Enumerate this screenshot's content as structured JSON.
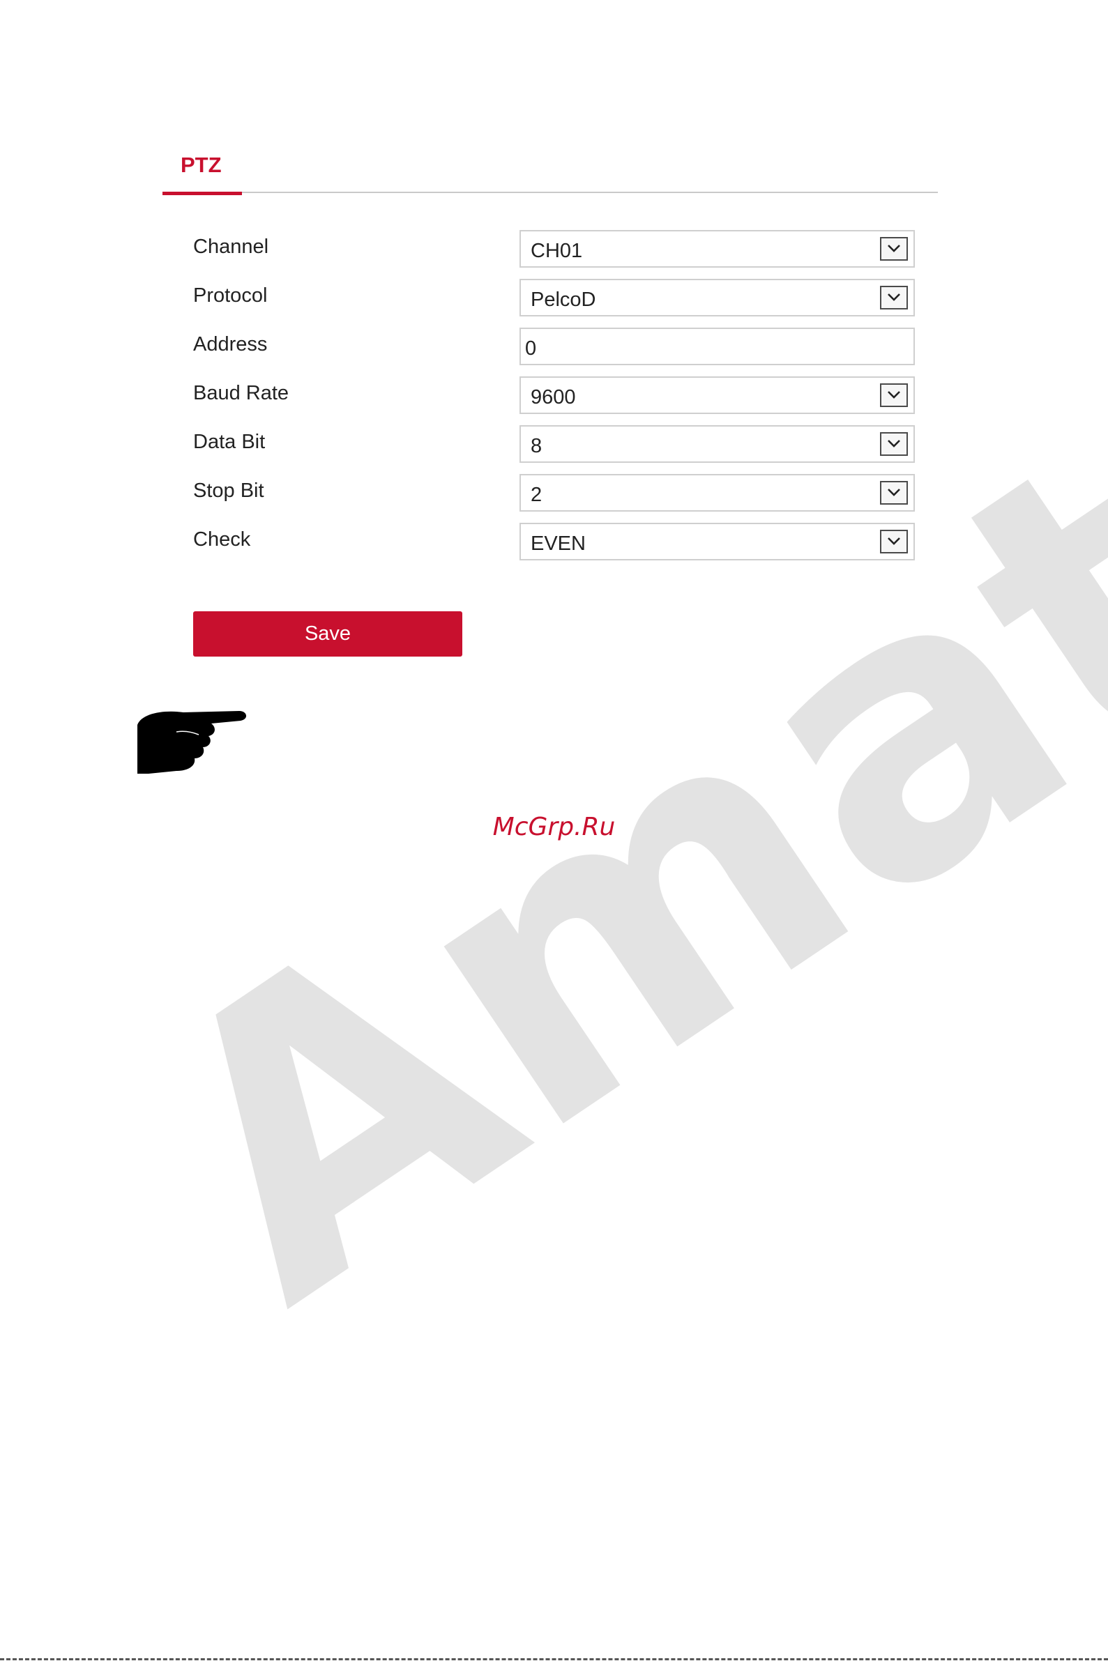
{
  "tab": {
    "label": "PTZ"
  },
  "form": {
    "channel": {
      "label": "Channel",
      "value": "CH01"
    },
    "protocol": {
      "label": "Protocol",
      "value": "PelcoD"
    },
    "address": {
      "label": "Address",
      "value": "0"
    },
    "baud_rate": {
      "label": "Baud Rate",
      "value": "9600"
    },
    "data_bit": {
      "label": "Data Bit",
      "value": "8"
    },
    "stop_bit": {
      "label": "Stop Bit",
      "value": "2"
    },
    "check": {
      "label": "Check",
      "value": "EVEN"
    }
  },
  "actions": {
    "save_label": "Save"
  },
  "site_mark": "McGrp.Ru",
  "watermark": "Amate",
  "colors": {
    "accent": "#c8102e",
    "watermark": "#e3e3e3"
  }
}
